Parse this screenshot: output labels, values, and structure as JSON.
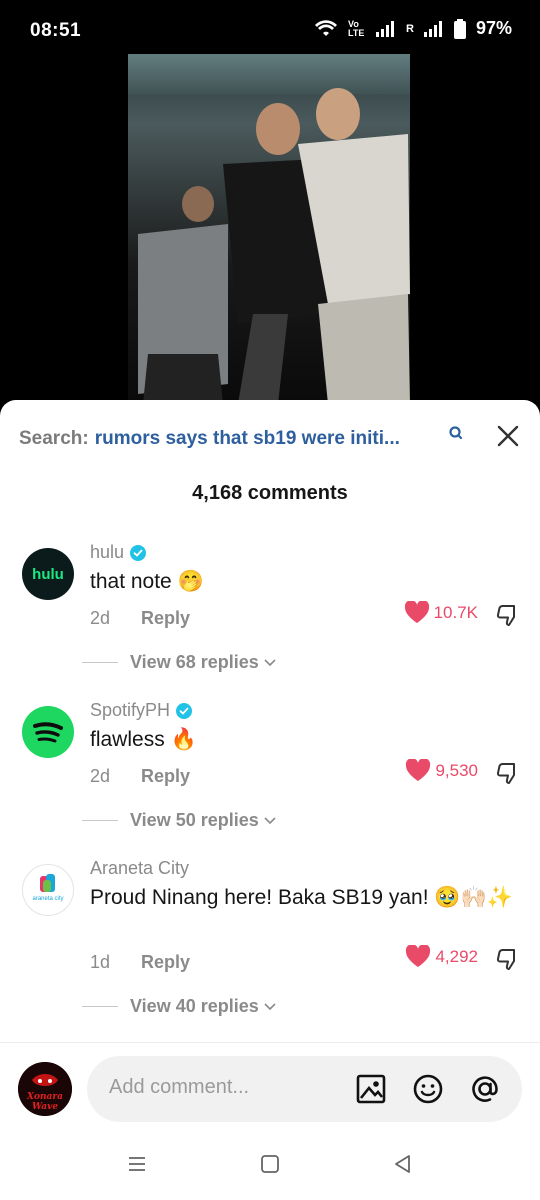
{
  "status_bar": {
    "time": "08:51",
    "network_label": "Vo LTE",
    "roaming_label": "R",
    "battery_percent": "97%"
  },
  "search": {
    "prefix": "Search:",
    "query": "rumors says that sb19 were initi..."
  },
  "comments_header": "4,168 comments",
  "comments": [
    {
      "username": "hulu",
      "verified": true,
      "avatar_text": "hulu",
      "text": "that note 🤭",
      "age": "2d",
      "reply_label": "Reply",
      "likes": "10.7K",
      "view_replies": "View 68 replies"
    },
    {
      "username": "SpotifyPH",
      "verified": true,
      "text": "flawless 🔥",
      "age": "2d",
      "reply_label": "Reply",
      "likes": "9,530",
      "view_replies": "View 50 replies"
    },
    {
      "username": "Araneta City",
      "verified": false,
      "avatar_text": "araneta city",
      "text": "Proud Ninang here! Baka SB19 yan! 🥹🙌🏻✨",
      "age": "1d",
      "reply_label": "Reply",
      "likes": "4,292",
      "view_replies": "View 40 replies"
    }
  ],
  "input": {
    "placeholder": "Add comment...",
    "avatar_text": "Xonara Wave"
  },
  "colors": {
    "accent_like": "#e84a68",
    "search_query": "#2e5f9e",
    "verified": "#20c3e6"
  }
}
